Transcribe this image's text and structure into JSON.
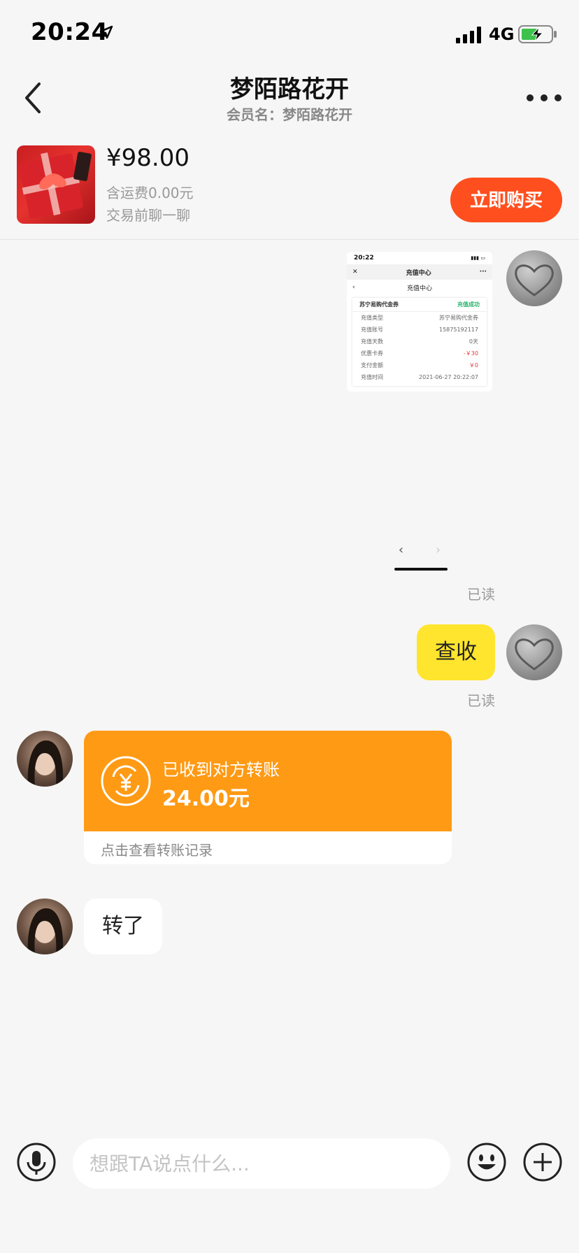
{
  "status_bar": {
    "time": "20:24",
    "network": "4G"
  },
  "nav": {
    "title": "梦陌路花开",
    "subtitle": "会员名：梦陌路花开"
  },
  "product": {
    "price": "¥98.00",
    "shipping": "含运费0.00元",
    "chat_hint": "交易前聊一聊",
    "buy_label": "立即购买"
  },
  "screenshot": {
    "status_time": "20:22",
    "header_title": "充值中心",
    "sub_title": "充值中心",
    "card_title": "苏宁易购代金券",
    "card_status": "充值成功",
    "rows": [
      {
        "label": "充值类型",
        "value": "苏宁易购代金券"
      },
      {
        "label": "充值账号",
        "value": "15875192117"
      },
      {
        "label": "充值天数",
        "value": "0天"
      },
      {
        "label": "优惠卡券",
        "value": "-￥30"
      },
      {
        "label": "支付金额",
        "value": "￥0"
      },
      {
        "label": "充值时间",
        "value": "2021-06-27 20:22:07"
      }
    ],
    "pager_prev": "‹",
    "pager_next": "›"
  },
  "messages": {
    "read_label_1": "已读",
    "yellow_text": "查收",
    "read_label_2": "已读",
    "transfer_title": "已收到对方转账",
    "transfer_amount": "24.00元",
    "transfer_link": "点击查看转账记录",
    "reply_text": "转了"
  },
  "input": {
    "placeholder": "想跟TA说点什么..."
  },
  "colors": {
    "accent_buy": "#ff4f1f",
    "bubble_yellow": "#ffe52d",
    "transfer_orange": "#ff9a14",
    "status_ok": "#27b36b"
  }
}
